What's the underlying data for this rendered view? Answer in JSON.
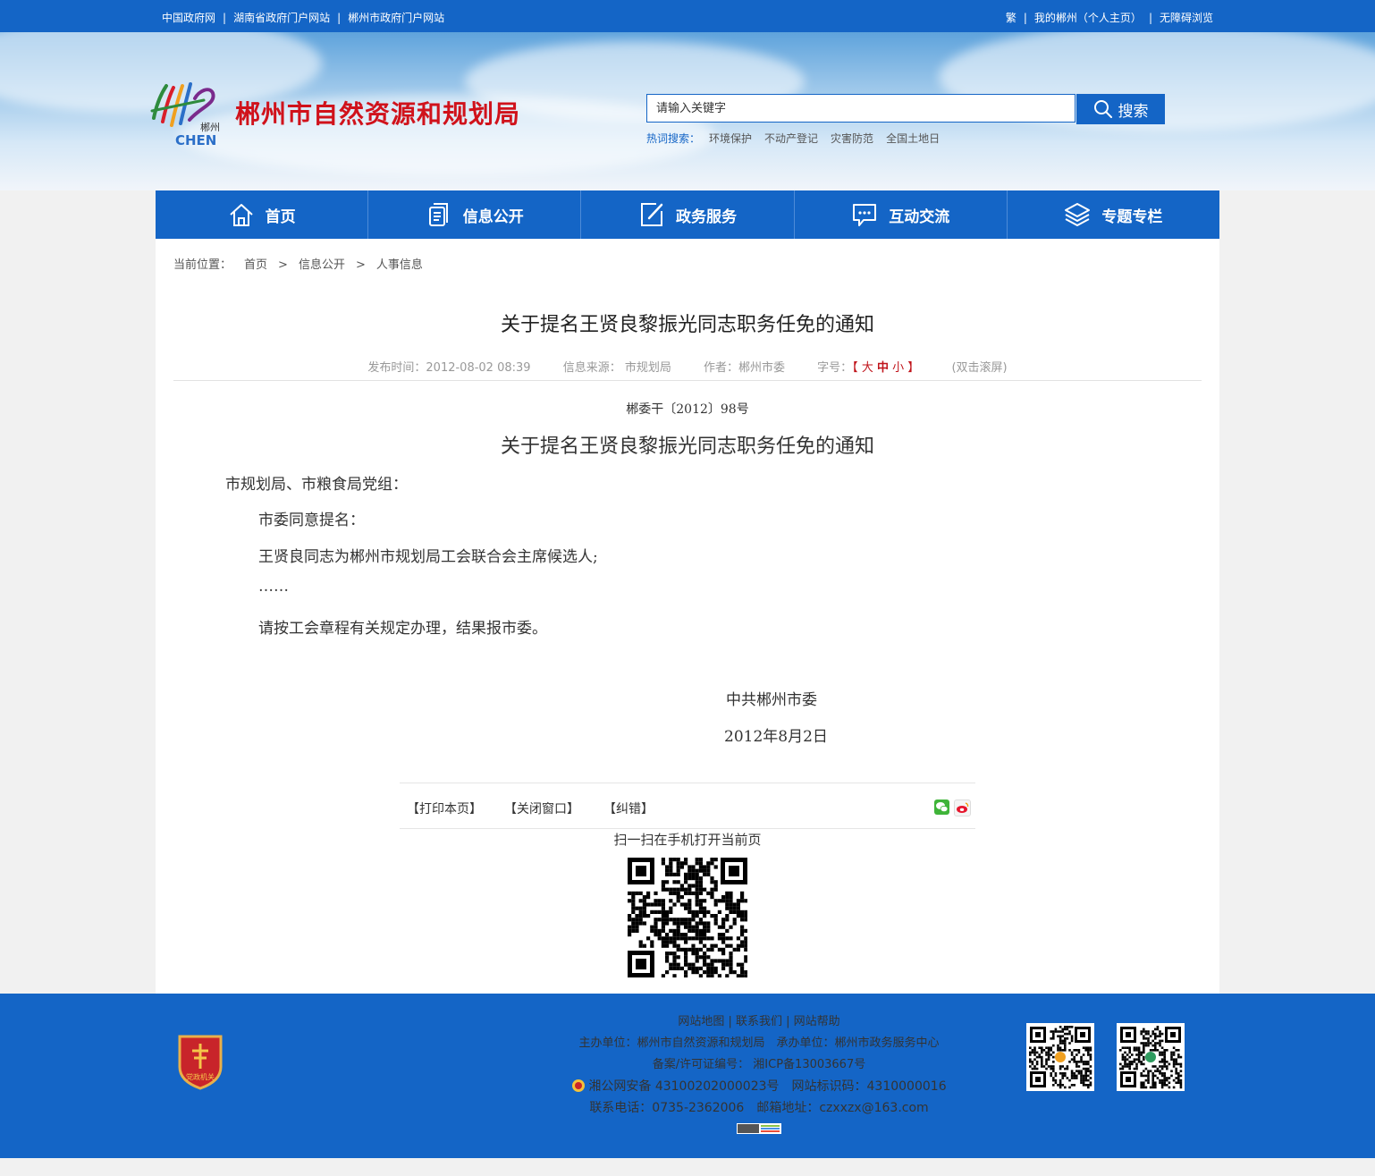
{
  "topbar": {
    "links": [
      "中国政府网",
      "湖南省政府门户网站",
      "郴州市政府门户网站"
    ],
    "right_links": [
      "繁",
      "我的郴州（个人主页）",
      "无障碍浏览"
    ]
  },
  "header": {
    "logo_text": "郴州 CHEN",
    "site_title": "郴州市自然资源和规划局",
    "search_placeholder": "请输入关键字",
    "search_button": "搜索",
    "hot_label": "热词搜索：",
    "hot_words": [
      "环境保护",
      "不动产登记",
      "灾害防范",
      "全国土地日"
    ]
  },
  "nav": {
    "items": [
      {
        "label": "首页",
        "icon": "home-icon"
      },
      {
        "label": "信息公开",
        "icon": "document-icon"
      },
      {
        "label": "政务服务",
        "icon": "edit-icon"
      },
      {
        "label": "互动交流",
        "icon": "chat-icon"
      },
      {
        "label": "专题专栏",
        "icon": "layers-icon"
      }
    ]
  },
  "breadcrumb": {
    "prefix": "当前位置：",
    "items": [
      "首页",
      "信息公开",
      "人事信息"
    ],
    "separator": ">"
  },
  "article": {
    "title": "关于提名王贤良黎振光同志职务任免的通知",
    "publish_time": "发布时间：2012-08-02 08:39",
    "source": "信息来源： 市规划局",
    "author": "作者：郴州市委",
    "font_size_label": "字号：",
    "font_size_open": "【",
    "font_sizes": [
      "大",
      "中",
      "小"
    ],
    "font_size_close": "】",
    "scroll_hint": "(双击滚屏)",
    "doc_number": "郴委干〔2012〕98号",
    "doc_title": "关于提名王贤良黎振光同志职务任免的通知",
    "recipient": "市规划局、市粮食局党组：",
    "paragraphs": [
      "市委同意提名：",
      "王贤良同志为郴州市规划局工会联合会主席候选人;",
      "……",
      "请按工会章程有关规定办理，结果报市委。"
    ],
    "signature": "中共郴州市委",
    "date": "2012年8月2日"
  },
  "tools": {
    "print": "【打印本页】",
    "close": "【关闭窗口】",
    "correct": "【纠错】",
    "share_icons": [
      "wechat-icon",
      "weibo-icon"
    ]
  },
  "qr_caption": "扫一扫在手机打开当前页",
  "footer": {
    "links": [
      "网站地图",
      "联系我们",
      "网站帮助"
    ],
    "host_line": "主办单位：郴州市自然资源和规划局　承办单位：郴州市政务服务中心",
    "icp_line": "备案/许可证编号： 湘ICP备13003667号",
    "police_line": "湘公网安备 43100202000023号　网站标识码：4310000016",
    "contact_line": "联系电话：0735-2362006　邮箱地址：czxxzx@163.com",
    "badge_text": "党政机关"
  },
  "colors": {
    "brand_blue": "#1465c6",
    "title_red": "#d0121b"
  }
}
